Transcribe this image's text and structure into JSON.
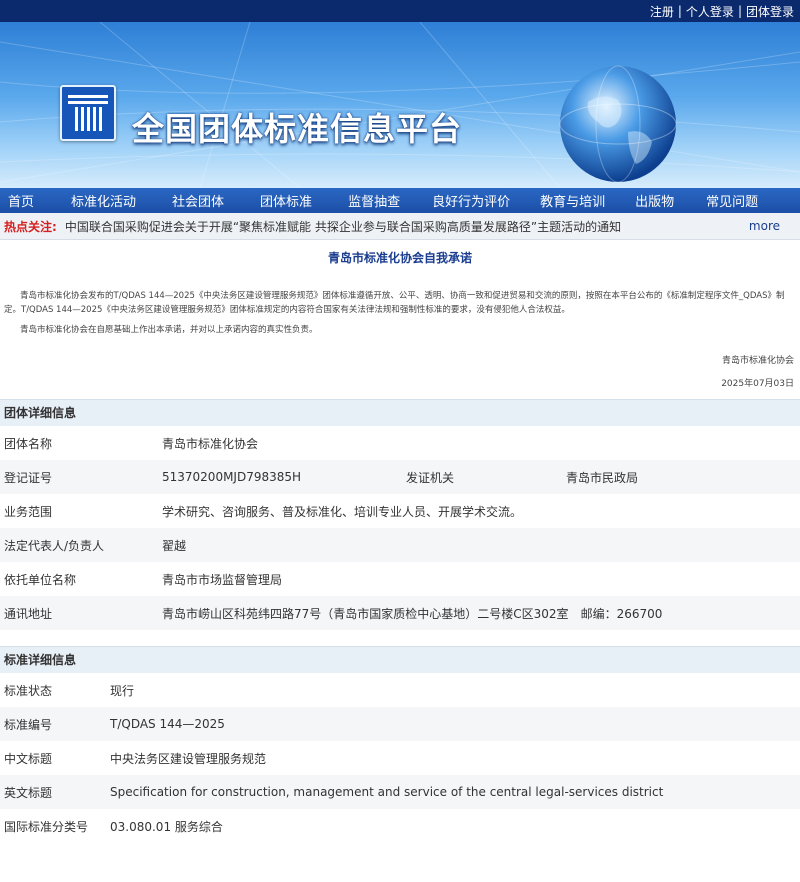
{
  "topbar": {
    "register": "注册",
    "login": "个人登录",
    "group_login": "团体登录"
  },
  "site": {
    "title": "全国团体标准信息平台"
  },
  "nav": [
    "首页",
    "标准化活动",
    "社会团体",
    "团体标准",
    "监督抽查",
    "良好行为评价",
    "教育与培训",
    "出版物",
    "常见问题"
  ],
  "hot": {
    "label": "热点关注:",
    "text": "中国联合国采购促进会关于开展“聚焦标准赋能 共探企业参与联合国采购高质量发展路径”主题活动的通知",
    "more": "more"
  },
  "page_title": "青岛市标准化协会自我承诺",
  "notice": {
    "p1": "青岛市标准化协会发布的T/QDAS 144—2025《中央法务区建设管理服务规范》团体标准遵循开放、公平、透明、协商一致和促进贸易和交流的原则，按照在本平台公布的《标准制定程序文件_QDAS》制定。T/QDAS 144—2025《中央法务区建设管理服务规范》团体标准规定的内容符合国家有关法律法规和强制性标准的要求，没有侵犯他人合法权益。",
    "p2": "青岛市标准化协会在自愿基础上作出本承诺，并对以上承诺内容的真实性负责。",
    "org": "青岛市标准化协会",
    "date": "2025年07月03日"
  },
  "org_info": {
    "title": "团体详细信息",
    "name_label": "团体名称",
    "name": "青岛市标准化协会",
    "reg_label": "登记证号",
    "reg": "51370200MJD798385H",
    "issuer_label": "发证机关",
    "issuer": "青岛市民政局",
    "scope_label": "业务范围",
    "scope": "学术研究、咨询服务、普及标准化、培训专业人员、开展学术交流。",
    "rep_label": "法定代表人/负责人",
    "rep": "翟越",
    "sponsor_label": "依托单位名称",
    "sponsor": "青岛市市场监督管理局",
    "addr_label": "通讯地址",
    "addr": "青岛市崂山区科苑纬四路77号（青岛市国家质检中心基地）二号楼C区302室",
    "zip": "邮编：266700"
  },
  "std_info": {
    "title": "标准详细信息",
    "status_label": "标准状态",
    "status": "现行",
    "code_label": "标准编号",
    "code": "T/QDAS 144—2025",
    "cn_label": "中文标题",
    "cn": "中央法务区建设管理服务规范",
    "en_label": "英文标题",
    "en": "Specification for construction, management and service of the central legal-services district",
    "ics_label": "国际标准分类号",
    "ics": "03.080.01 服务综合"
  },
  "colors": {
    "topbar": "#0b2a6e",
    "nav": "#1c4fa6",
    "hot_label": "#d42020",
    "title_blue": "#1a3d8f",
    "section_bg": "#e7eff7"
  },
  "icons": {
    "logo": "standard-logo-icon",
    "globe": "globe-icon"
  }
}
